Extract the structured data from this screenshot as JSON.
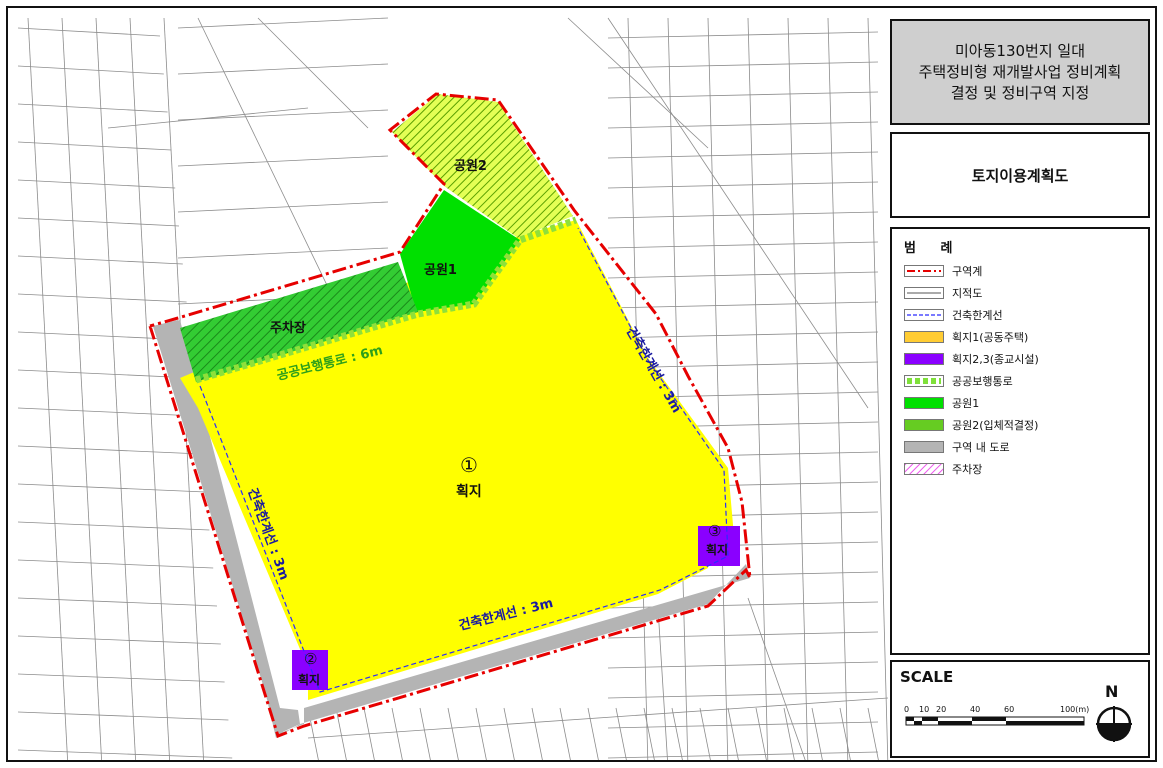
{
  "title": {
    "line1": "미아동130번지 일대",
    "line2": "주택정비형 재개발사업 정비계획",
    "line3": "결정 및 정비구역 지정"
  },
  "subtitle": "토지이용계획도",
  "legend": {
    "title": "범 례",
    "items": [
      {
        "key": "boundary",
        "label": "구역계"
      },
      {
        "key": "cadastral",
        "label": "지적도"
      },
      {
        "key": "buildline",
        "label": "건축한계선"
      },
      {
        "key": "lot1",
        "label": "획지1(공동주택)"
      },
      {
        "key": "lot23",
        "label": "획지2,3(종교시설)"
      },
      {
        "key": "walkway",
        "label": "공공보행통로"
      },
      {
        "key": "park1",
        "label": "공원1"
      },
      {
        "key": "park2",
        "label": "공원2(입체적결정)"
      },
      {
        "key": "road",
        "label": "구역 내 도로"
      },
      {
        "key": "parking",
        "label": "주차장"
      }
    ]
  },
  "map_labels": {
    "park2": "공원2",
    "park1": "공원1",
    "parking": "주차장",
    "walkway": "공공보행통로 : 6m",
    "buildline_right": "건축한계선 : 3m",
    "buildline_left": "건축한계선 : 3m",
    "buildline_bottom": "건축한계선 : 3m",
    "lot1_num": "①",
    "lot1": "획지",
    "lot2_num": "②",
    "lot2": "획지",
    "lot3_num": "③",
    "lot3": "획지"
  },
  "scale": {
    "title": "SCALE",
    "ticks": [
      "0",
      "10",
      "20",
      "40",
      "60",
      "100(m)"
    ],
    "north": "N"
  },
  "colors": {
    "lot1": "#ffff00",
    "lot23": "#8a00ff",
    "park1": "#00e000",
    "park2": "#d8ff33",
    "road": "#b4b4b4",
    "boundary": "#e60000",
    "walkway": "#7fe03a",
    "parking_legend": "#ee66ee"
  }
}
